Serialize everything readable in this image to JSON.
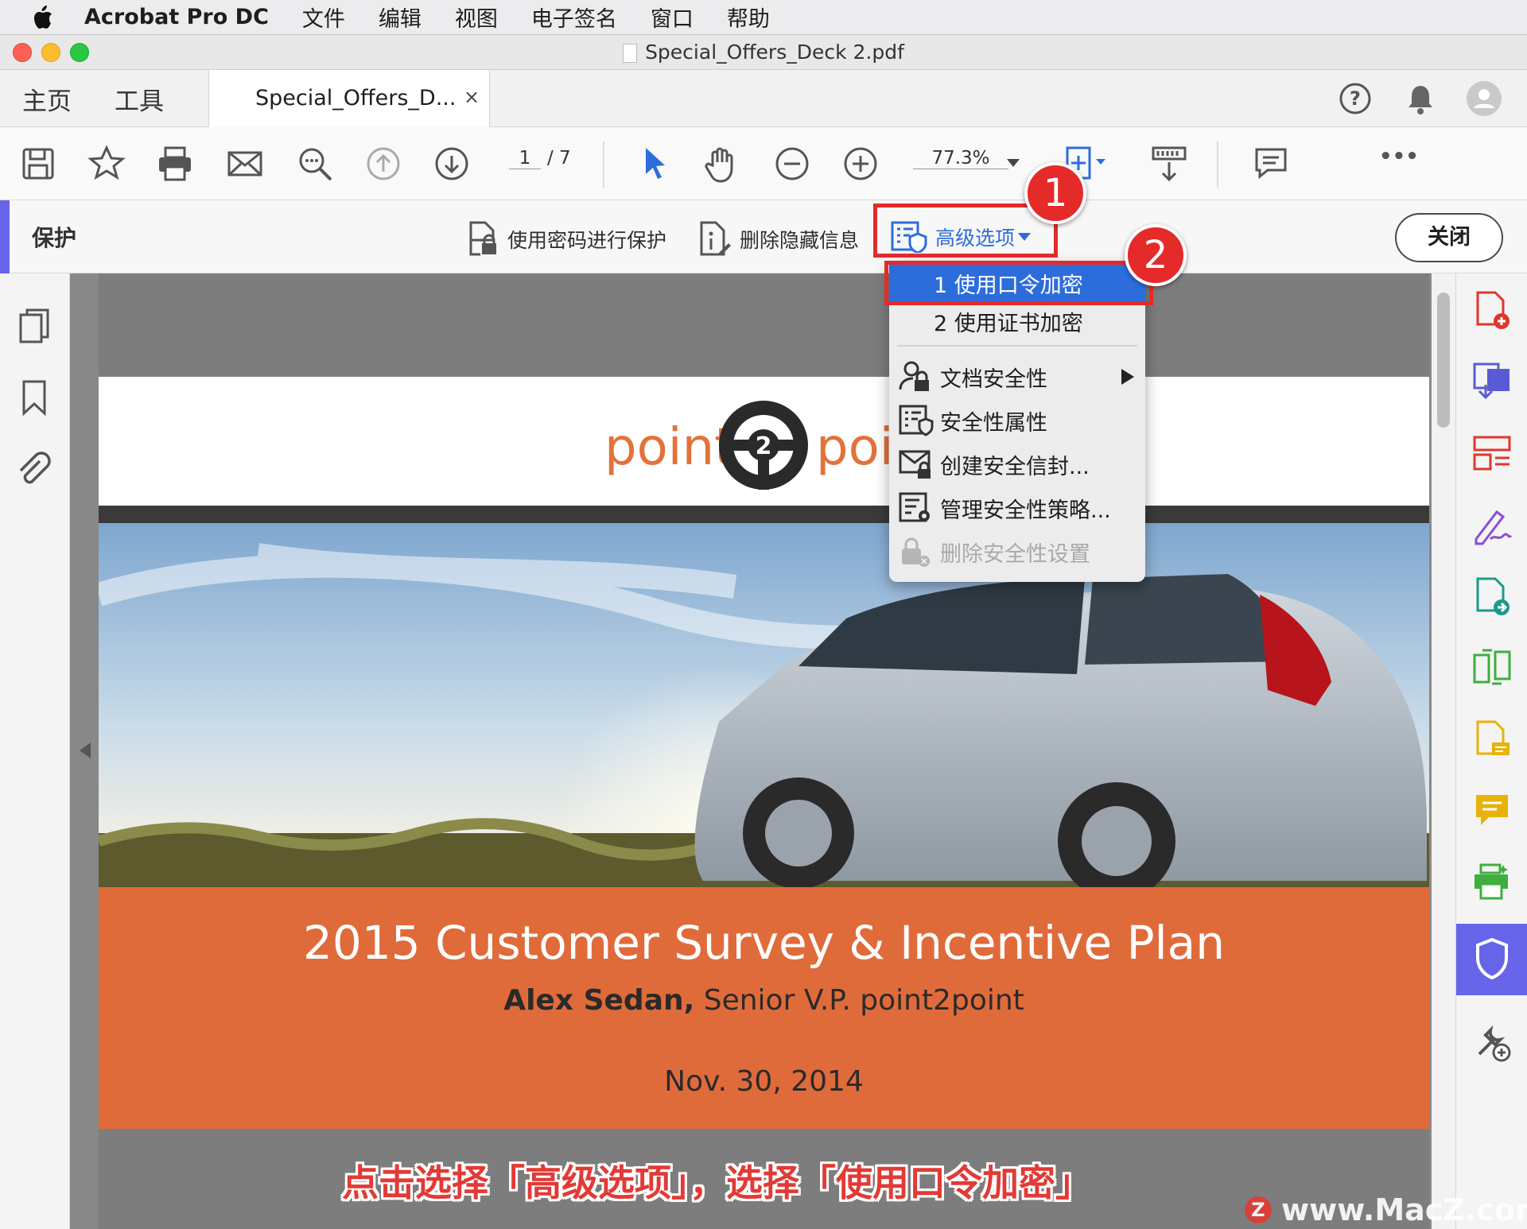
{
  "menubar": {
    "app": "Acrobat Pro DC",
    "items": [
      "文件",
      "编辑",
      "视图",
      "电子签名",
      "窗口",
      "帮助"
    ]
  },
  "window": {
    "title": "Special_Offers_Deck 2.pdf"
  },
  "tabs": {
    "home": "主页",
    "tools": "工具",
    "doc_tab": "Special_Offers_D...",
    "close": "×"
  },
  "toolbar": {
    "page_current": "1",
    "page_total": "/ 7",
    "zoom": "77.3%",
    "more": "•••"
  },
  "protect": {
    "title": "保护",
    "password_protect": "使用密码进行保护",
    "remove_hidden": "删除隐藏信息",
    "advanced": "高级选项",
    "close": "关闭"
  },
  "menu": {
    "encrypt_password": "1 使用口令加密",
    "encrypt_cert": "2 使用证书加密",
    "doc_security": "文档安全性",
    "security_props": "安全性属性",
    "create_envelope": "创建安全信封...",
    "manage_policies": "管理安全性策略...",
    "remove_security": "删除安全性设置"
  },
  "document": {
    "logo_left": "point",
    "logo_center": "2",
    "logo_right": "poi",
    "headline": "2015 Customer Survey & Incentive Plan",
    "author_name": "Alex Sedan,",
    "author_role": " Senior V.P. point2point",
    "date": "Nov. 30, 2014"
  },
  "annotations": {
    "badge1": "1",
    "badge2": "2",
    "caption": "点击选择「高级选项」，选择「使用口令加密」",
    "watermark_logo": "Z",
    "watermark": "www.MacZ.com"
  },
  "colors": {
    "accent": "#6665e9",
    "orange": "#e06b3a",
    "highlight": "#2d6ddb",
    "annotation_red": "#e52a2a"
  }
}
